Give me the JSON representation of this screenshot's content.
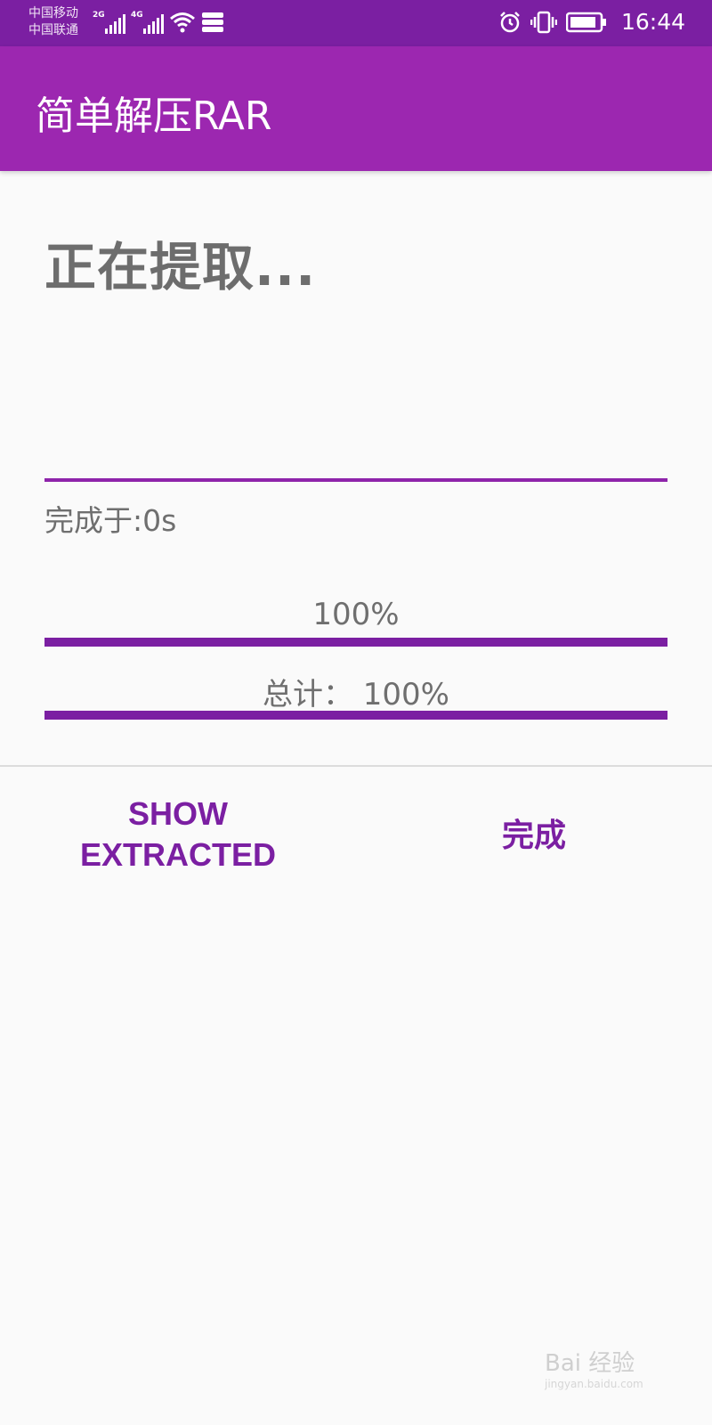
{
  "status_bar": {
    "carrier_1": "中国移动",
    "carrier_2": "中国联通",
    "net_1": "2G",
    "net_2": "4G",
    "time": "16:44",
    "icons": [
      "signal-icon",
      "wifi-icon",
      "data-icon",
      "alarm-icon",
      "vibrate-icon",
      "battery-icon"
    ]
  },
  "app_bar": {
    "title": "简单解压RAR"
  },
  "extraction": {
    "title": "正在提取...",
    "elapsed": "完成于:0s",
    "file_progress_label": "100%",
    "file_progress_value": 1.0,
    "total_progress_label": "总计： 100%",
    "total_progress_value": 1.0
  },
  "actions": {
    "show_extracted_label": "SHOW EXTRACTED",
    "done_label": "完成"
  },
  "watermark": {
    "text": "Bai 经验",
    "subtext": "jingyan.baidu.com"
  },
  "colors": {
    "primary": "#9c27b0",
    "primary_dark": "#7b1fa2",
    "text_gray": "#6f6f6f"
  }
}
